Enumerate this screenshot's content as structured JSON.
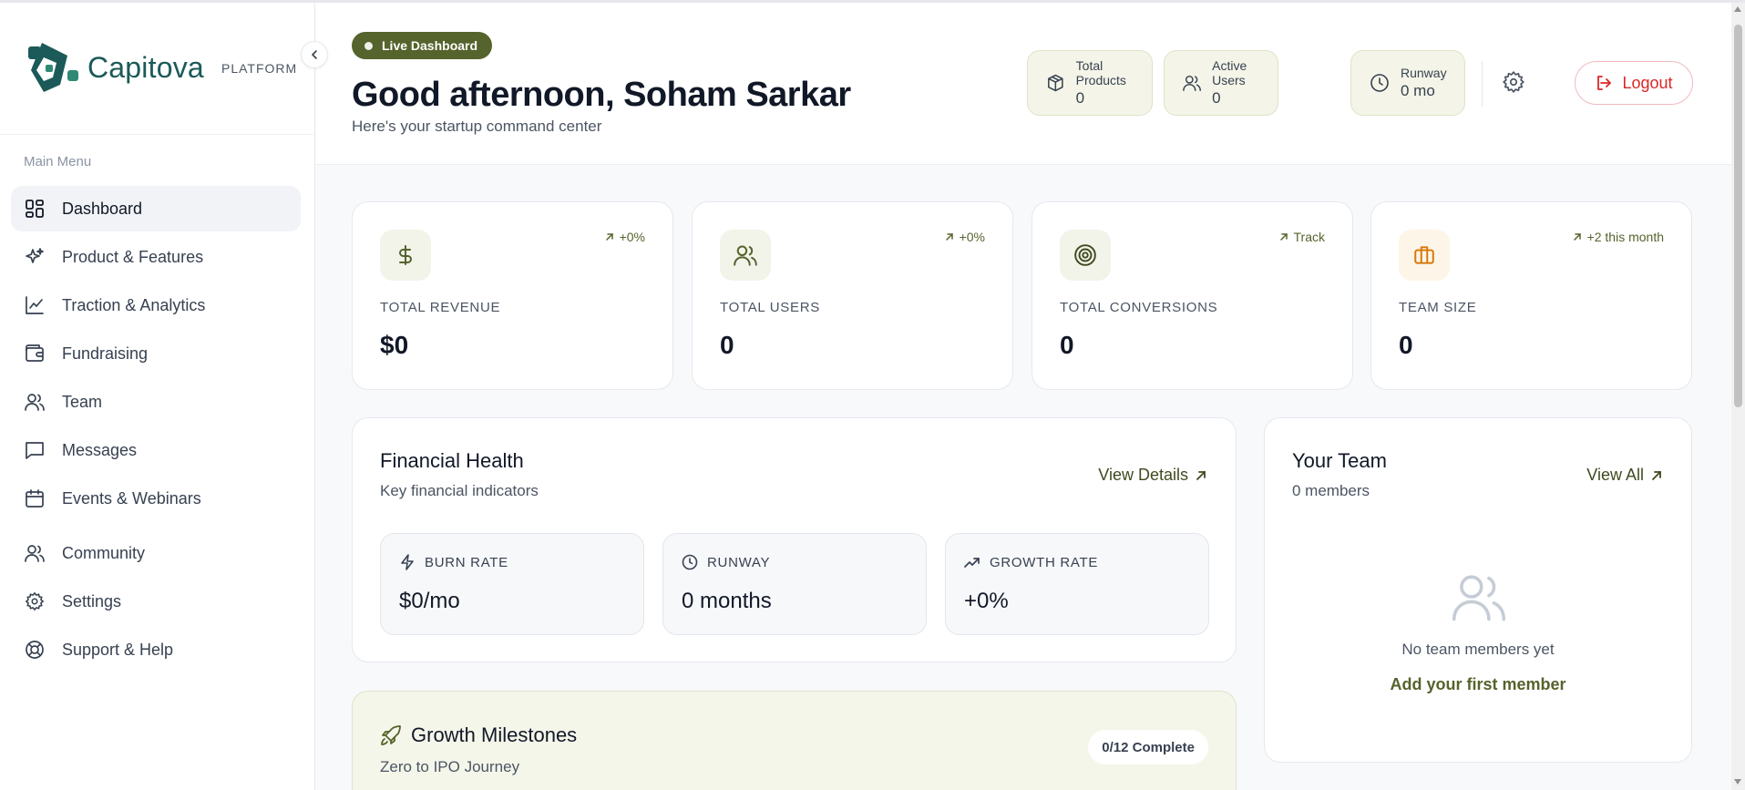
{
  "brand": {
    "name": "Capitova",
    "tag": "PLATFORM"
  },
  "sidebar": {
    "menu_title": "Main Menu",
    "items": [
      {
        "label": "Dashboard",
        "icon": "dashboard-icon",
        "active": true
      },
      {
        "label": "Product & Features",
        "icon": "sparkles-icon"
      },
      {
        "label": "Traction & Analytics",
        "icon": "line-chart-icon"
      },
      {
        "label": "Fundraising",
        "icon": "wallet-icon"
      },
      {
        "label": "Team",
        "icon": "users-icon"
      },
      {
        "label": "Messages",
        "icon": "message-icon"
      },
      {
        "label": "Events & Webinars",
        "icon": "calendar-icon"
      },
      {
        "label": "Community",
        "icon": "users-icon"
      },
      {
        "label": "Settings",
        "icon": "gear-icon"
      },
      {
        "label": "Support & Help",
        "icon": "lifebuoy-icon"
      }
    ]
  },
  "header": {
    "badge": "Live Dashboard",
    "greeting": "Good afternoon, Soham Sarkar",
    "subtitle": "Here's your startup command center",
    "stats": [
      {
        "label": "Total Products",
        "value": "0",
        "icon": "package-icon"
      },
      {
        "label": "Active Users",
        "value": "0",
        "icon": "users-icon"
      },
      {
        "label": "Runway",
        "value": "0 mo",
        "icon": "clock-icon"
      }
    ],
    "logout_label": "Logout"
  },
  "kpis": [
    {
      "label": "TOTAL REVENUE",
      "value": "$0",
      "trend": "+0%",
      "icon": "dollar-icon"
    },
    {
      "label": "TOTAL USERS",
      "value": "0",
      "trend": "+0%",
      "icon": "users-icon"
    },
    {
      "label": "TOTAL CONVERSIONS",
      "value": "0",
      "trend": "Track",
      "icon": "target-icon"
    },
    {
      "label": "TEAM SIZE",
      "value": "0",
      "trend": "+2 this month",
      "icon": "briefcase-icon"
    }
  ],
  "financial": {
    "title": "Financial Health",
    "subtitle": "Key financial indicators",
    "link": "View Details",
    "metrics": [
      {
        "label": "BURN RATE",
        "value": "$0/mo",
        "icon": "lightning-icon"
      },
      {
        "label": "RUNWAY",
        "value": "0 months",
        "icon": "clock-icon"
      },
      {
        "label": "GROWTH RATE",
        "value": "+0%",
        "icon": "trending-up-icon"
      }
    ]
  },
  "team": {
    "title": "Your Team",
    "subtitle": "0 members",
    "link": "View All",
    "empty_text": "No team members yet",
    "empty_action": "Add your first member"
  },
  "milestones": {
    "title": "Growth Milestones",
    "subtitle": "Zero to IPO Journey",
    "badge": "0/12 Complete"
  },
  "colors": {
    "accent": "#55632c",
    "brand": "#1b5a58",
    "logout": "#dc2626"
  }
}
